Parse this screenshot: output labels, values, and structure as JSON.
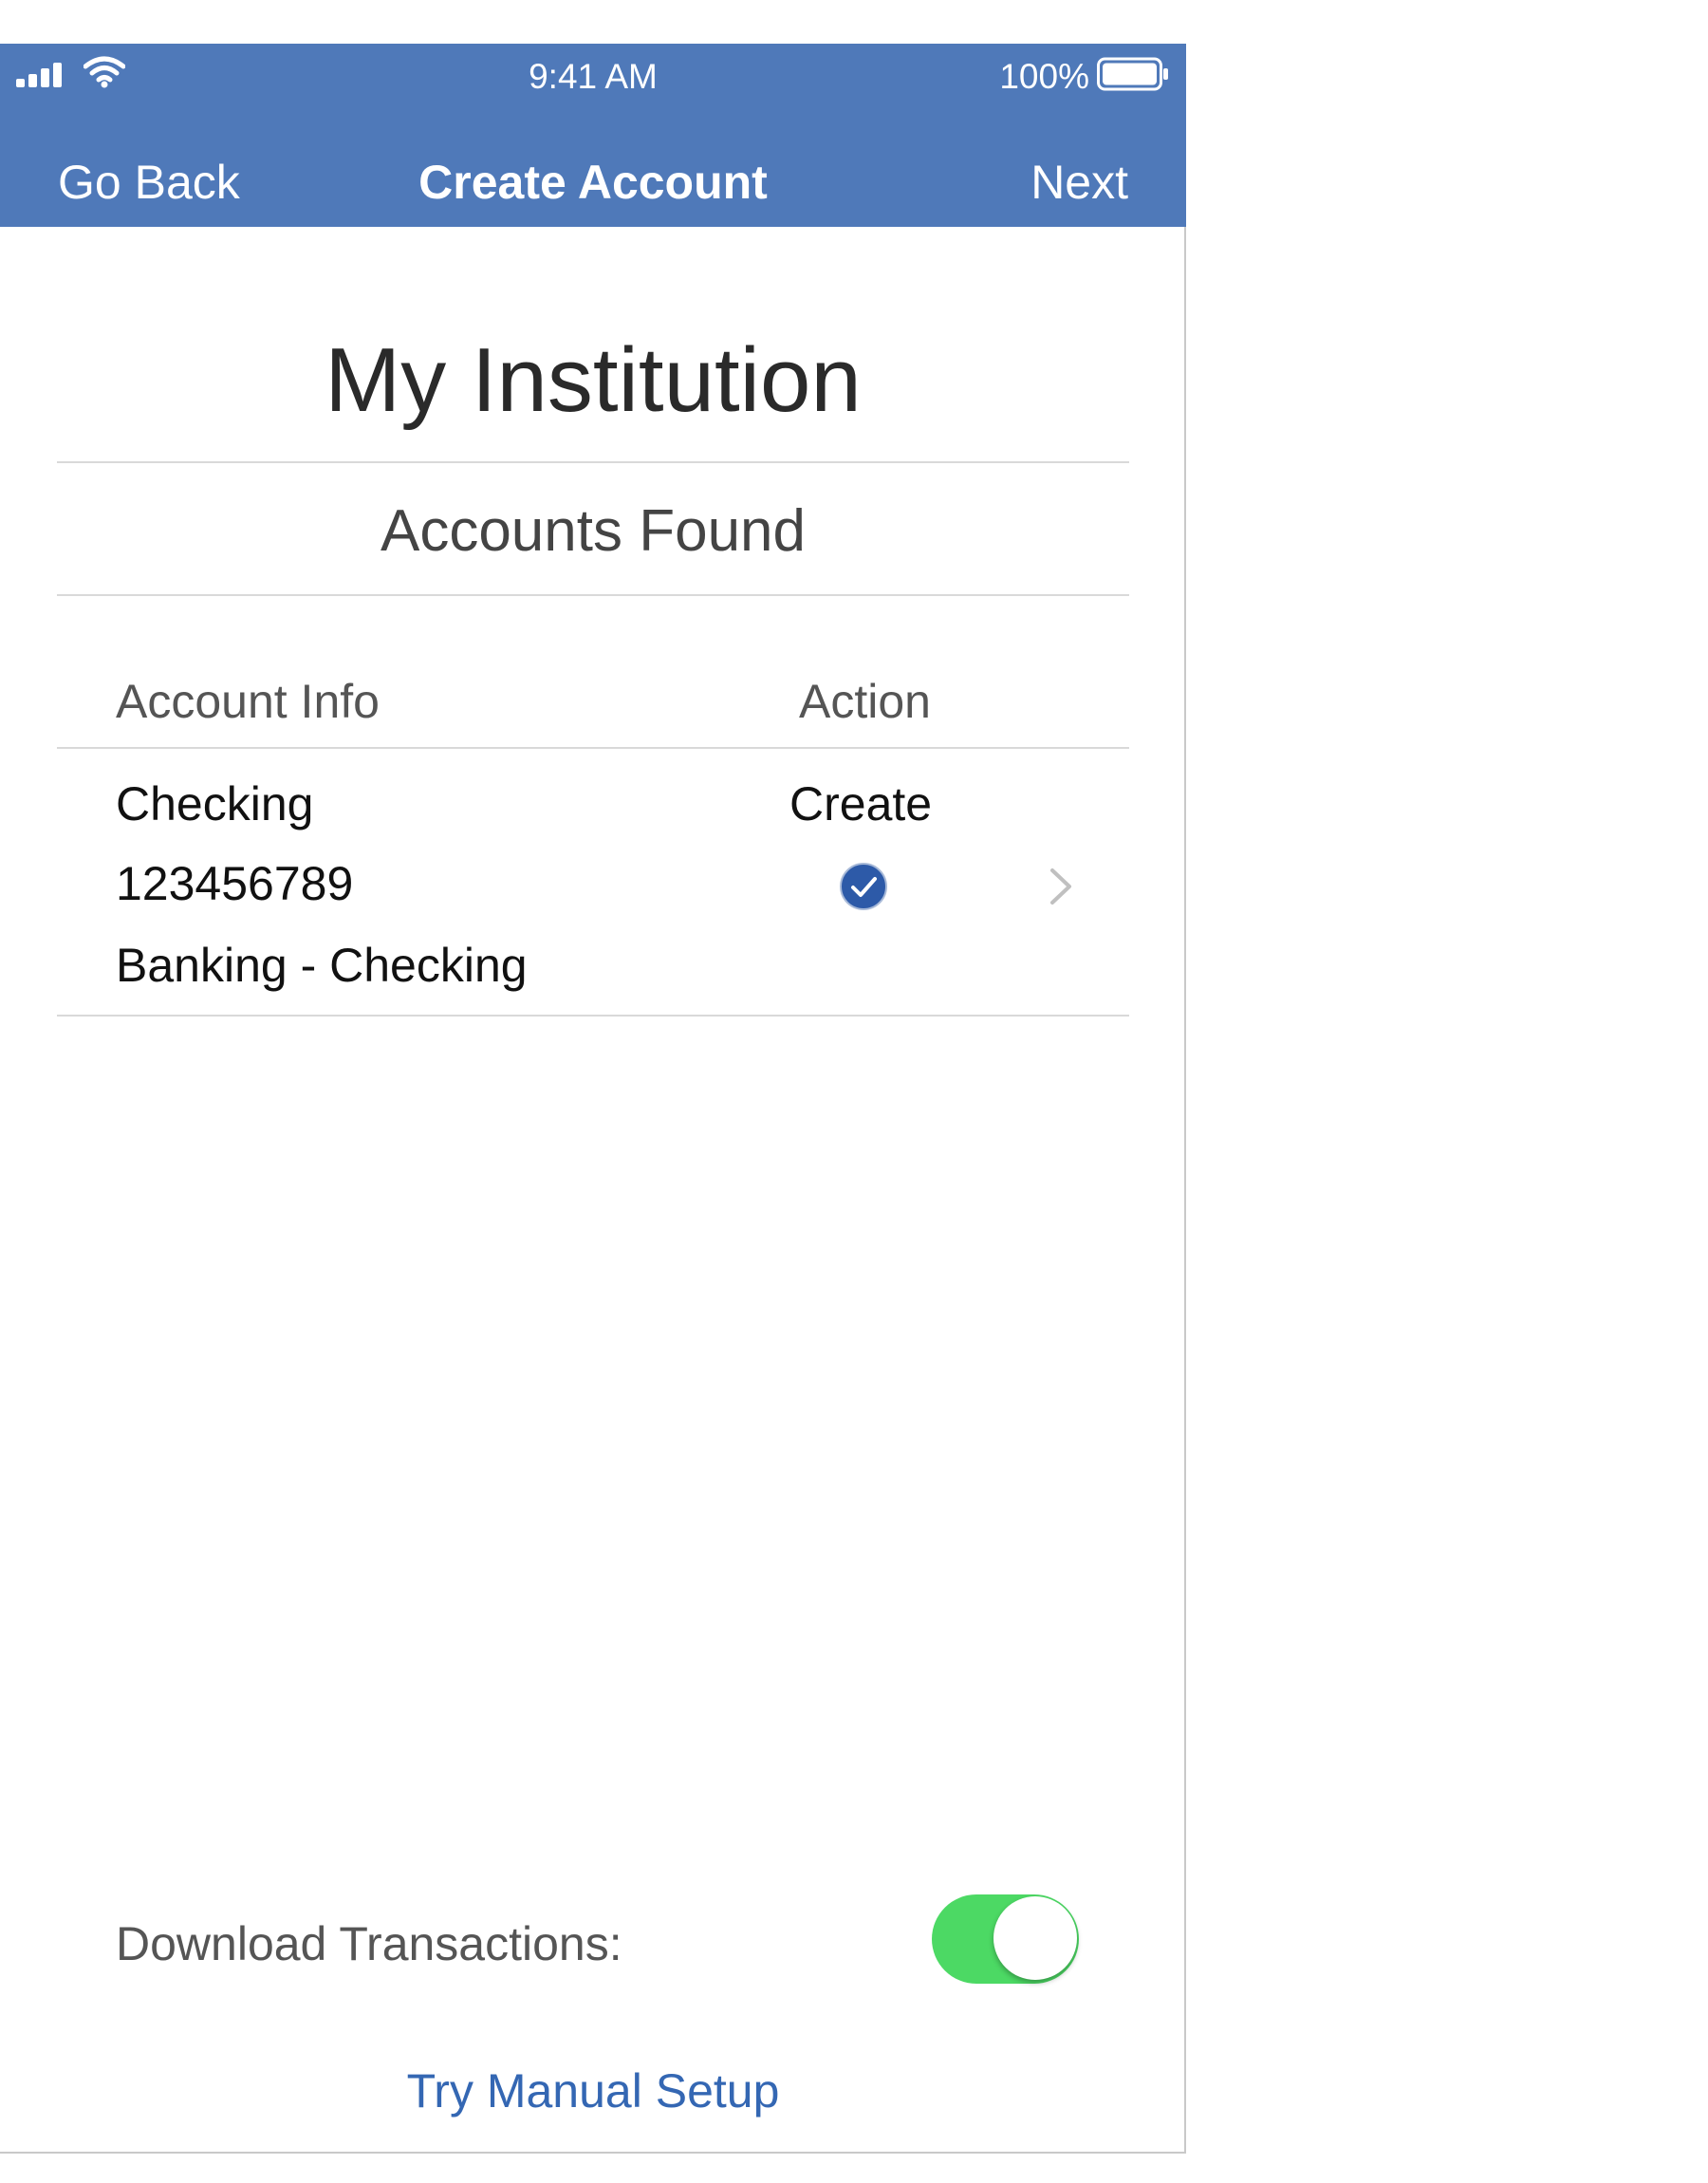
{
  "status_bar": {
    "time": "9:41 AM",
    "battery_percent": "100%",
    "signal_bars": 4,
    "icons": [
      "cellular-signal-icon",
      "wifi-icon",
      "battery-icon"
    ]
  },
  "nav": {
    "back_label": "Go Back",
    "title": "Create Account",
    "next_label": "Next",
    "color": "#4f79b9"
  },
  "institution": "My Institution",
  "section_title": "Accounts Found",
  "table": {
    "headers": [
      "Account Info",
      "Action"
    ],
    "rows": [
      {
        "name": "Checking",
        "number": "123456789",
        "type": "Banking - Checking",
        "action": "Create",
        "selected": true
      }
    ]
  },
  "download_transactions": {
    "label": "Download Transactions:",
    "enabled": true,
    "toggle_color": "#4cd964"
  },
  "manual_setup_label": "Try Manual Setup",
  "link_color": "#3467b3"
}
